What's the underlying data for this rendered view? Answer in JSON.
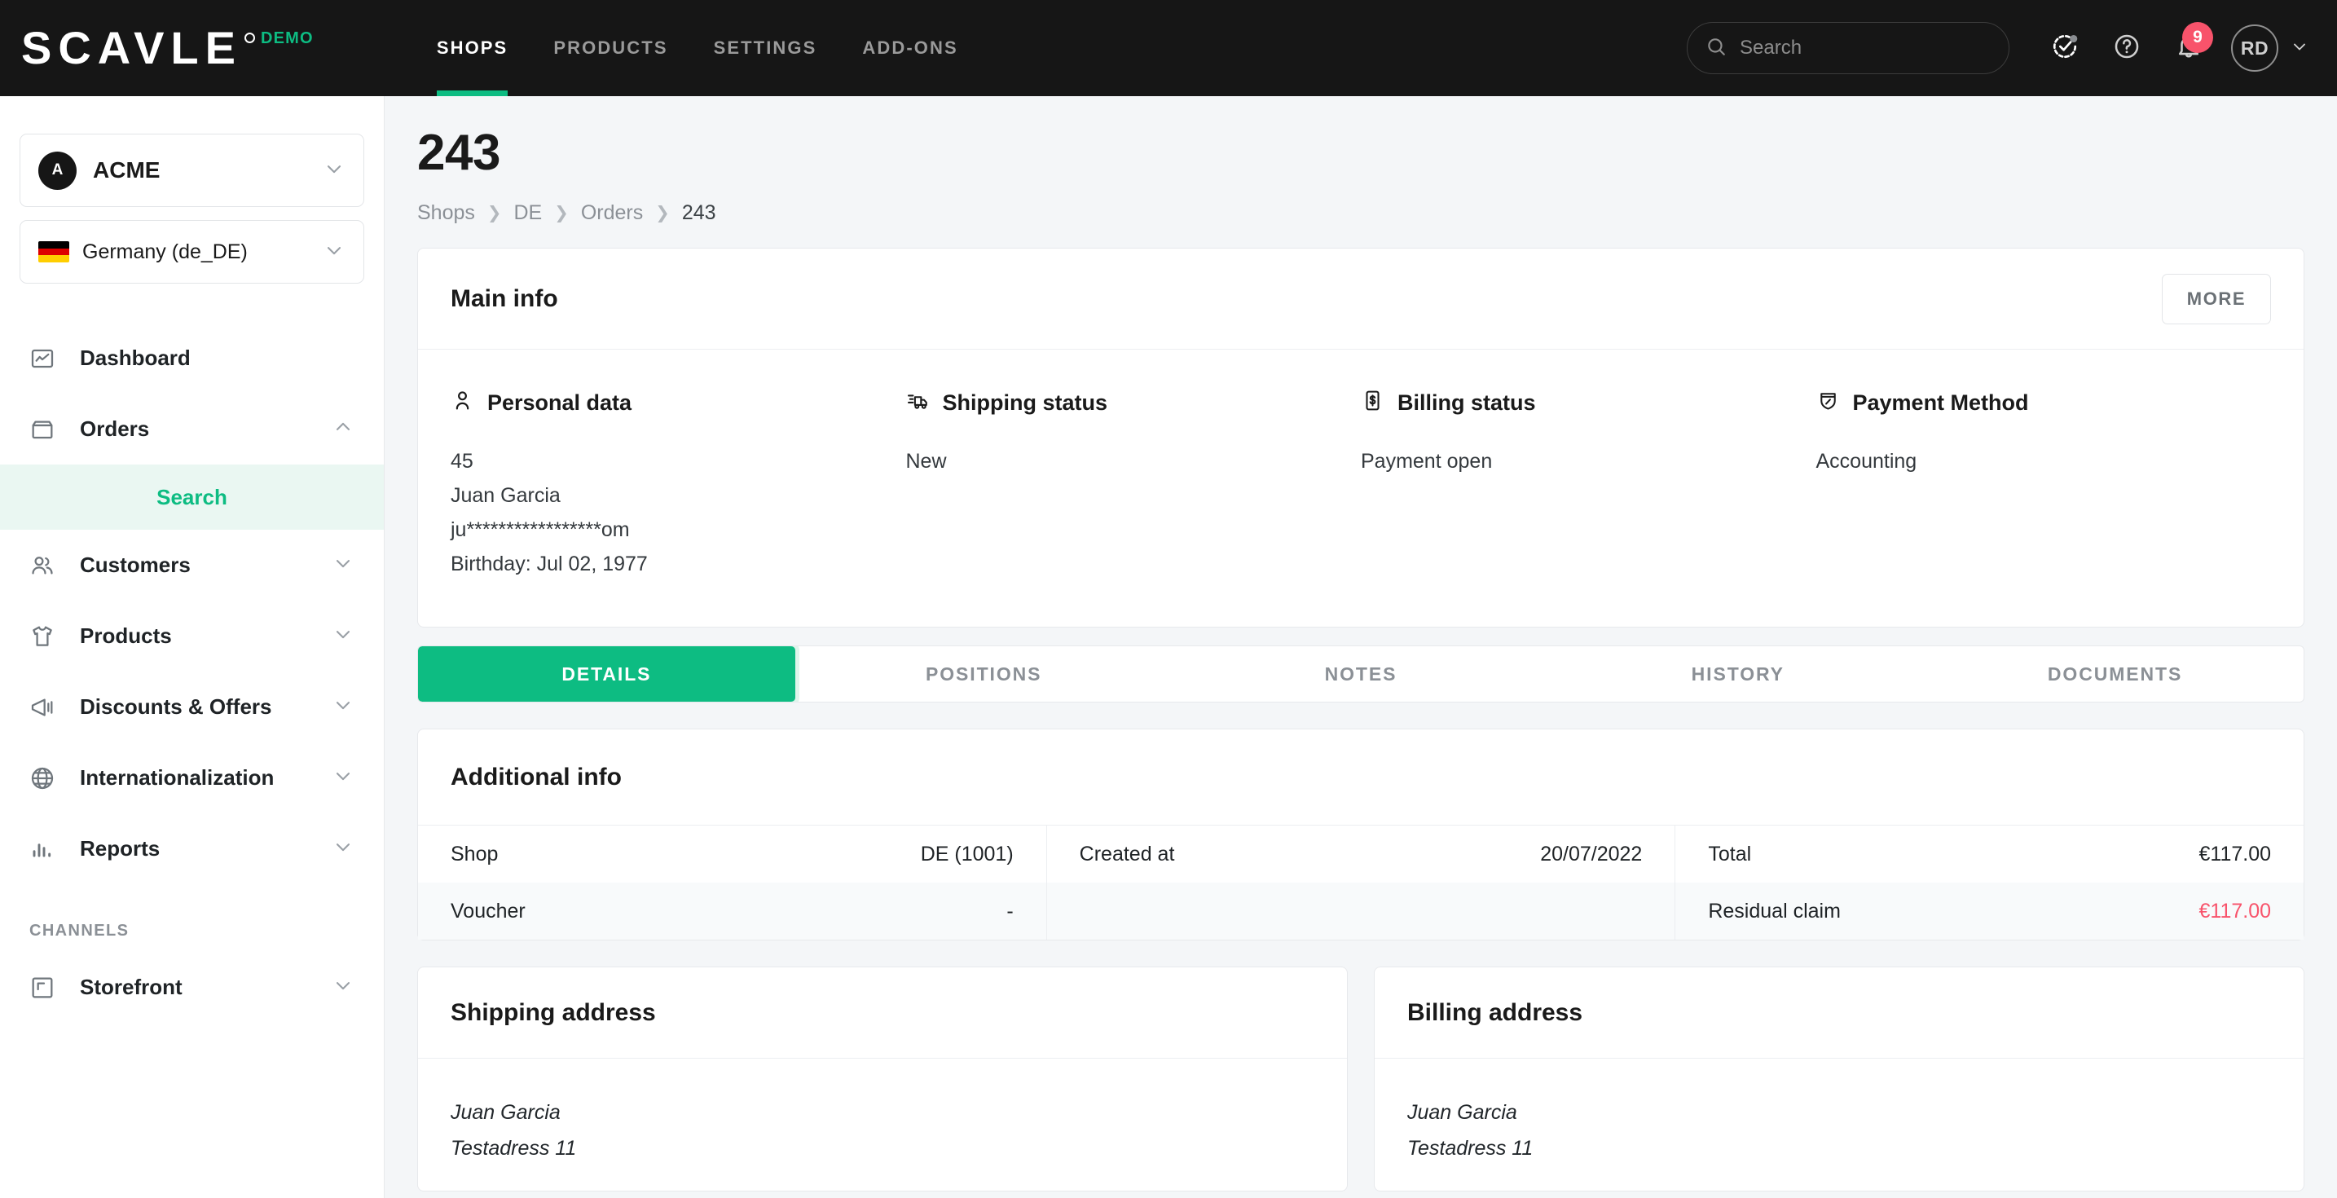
{
  "topbar": {
    "logo_text": "SCAVLE",
    "demo_badge": "DEMO",
    "nav": [
      {
        "label": "SHOPS",
        "active": true
      },
      {
        "label": "PRODUCTS",
        "active": false
      },
      {
        "label": "SETTINGS",
        "active": false
      },
      {
        "label": "ADD-ONS",
        "active": false
      }
    ],
    "search": {
      "placeholder": "Search",
      "value": "",
      "icon": "search-icon"
    },
    "tasks_icon": "tasks-check-icon",
    "help_icon": "help-circle-icon",
    "bell_icon": "bell-icon",
    "notification_count": "9",
    "avatar_initials": "RD",
    "avatar_chevron": "chevron-down-icon",
    "accent_color": "#0dbc82",
    "badge_color": "#f8536b"
  },
  "sidebar": {
    "tenant": {
      "initial": "A",
      "name": "ACME"
    },
    "locale": {
      "name": "Germany (de_DE)",
      "flag": "german-flag-icon"
    },
    "items": [
      {
        "label": "Dashboard",
        "icon": "dashboard-chart-icon",
        "expandable": false
      },
      {
        "label": "Orders",
        "icon": "orders-box-icon",
        "expandable": true,
        "expanded": true
      },
      {
        "label": "Customers",
        "icon": "customers-people-icon",
        "expandable": true,
        "expanded": false
      },
      {
        "label": "Products",
        "icon": "products-shirt-icon",
        "expandable": true,
        "expanded": false
      },
      {
        "label": "Discounts & Offers",
        "icon": "megaphone-icon",
        "expandable": true,
        "expanded": false
      },
      {
        "label": "Internationalization",
        "icon": "globe-icon",
        "expandable": true,
        "expanded": false
      },
      {
        "label": "Reports",
        "icon": "reports-bars-icon",
        "expandable": true,
        "expanded": false
      }
    ],
    "orders_sub": [
      {
        "label": "Search",
        "active": true
      }
    ],
    "section_channels": "CHANNELS",
    "channels": [
      {
        "label": "Storefront",
        "icon": "storefront-frame-icon",
        "expandable": true,
        "expanded": false
      }
    ]
  },
  "page": {
    "title": "243",
    "breadcrumb": [
      {
        "label": "Shops",
        "current": false
      },
      {
        "label": "DE",
        "current": false
      },
      {
        "label": "Orders",
        "current": false
      },
      {
        "label": "243",
        "current": true
      }
    ]
  },
  "main_info": {
    "title": "Main info",
    "more_label": "MORE",
    "columns": [
      {
        "icon": "person-icon",
        "heading": "Personal data",
        "lines": [
          "45",
          "Juan Garcia",
          "ju*****************om",
          "Birthday: Jul 02, 1977"
        ]
      },
      {
        "icon": "shipping-truck-icon",
        "heading": "Shipping status",
        "lines": [
          "New"
        ]
      },
      {
        "icon": "billing-dollar-icon",
        "heading": "Billing status",
        "lines": [
          "Payment open"
        ]
      },
      {
        "icon": "payment-shield-icon",
        "heading": "Payment Method",
        "lines": [
          "Accounting"
        ]
      }
    ]
  },
  "tabs": [
    {
      "label": "DETAILS",
      "active": true
    },
    {
      "label": "POSITIONS",
      "active": false
    },
    {
      "label": "NOTES",
      "active": false
    },
    {
      "label": "HISTORY",
      "active": false
    },
    {
      "label": "DOCUMENTS",
      "active": false
    }
  ],
  "additional_info": {
    "title": "Additional info",
    "columns": [
      {
        "rows": [
          {
            "key": "Shop",
            "value": "DE (1001)",
            "alt": false,
            "red": false
          },
          {
            "key": "Voucher",
            "value": "-",
            "alt": true,
            "red": false
          }
        ]
      },
      {
        "rows": [
          {
            "key": "Created at",
            "value": "20/07/2022",
            "alt": false,
            "red": false
          },
          {
            "key": "",
            "value": "",
            "alt": true,
            "red": false
          }
        ]
      },
      {
        "rows": [
          {
            "key": "Total",
            "value": "€117.00",
            "alt": false,
            "red": false
          },
          {
            "key": "Residual claim",
            "value": "€117.00",
            "alt": true,
            "red": true
          }
        ]
      }
    ]
  },
  "addresses": [
    {
      "title": "Shipping address",
      "lines": [
        "Juan Garcia",
        "Testadress 11"
      ]
    },
    {
      "title": "Billing address",
      "lines": [
        "Juan Garcia",
        "Testadress 11"
      ]
    }
  ]
}
